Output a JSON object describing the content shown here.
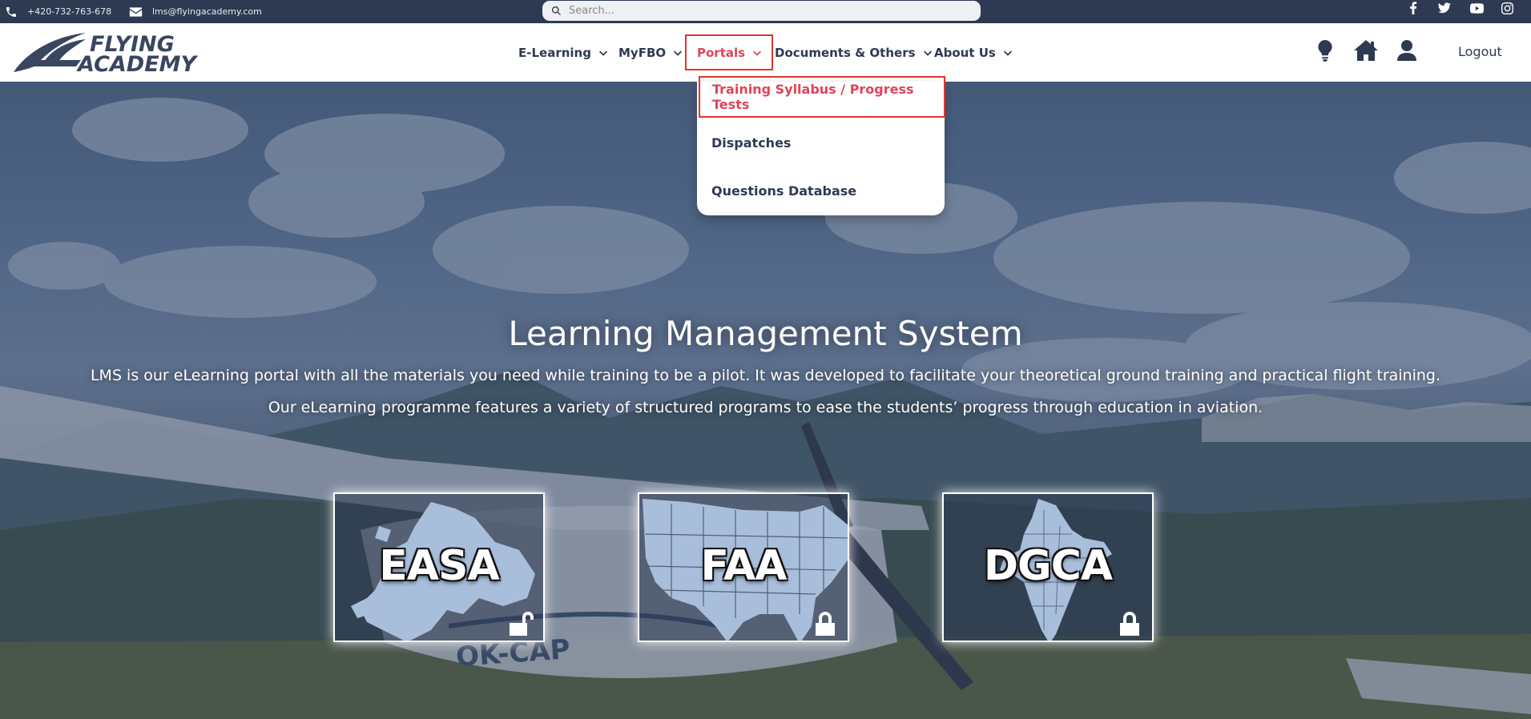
{
  "topbar": {
    "phone": "+420-732-763-678",
    "email": "lms@flyingacademy.com",
    "search_placeholder": "Search...",
    "social": [
      "facebook-icon",
      "twitter-icon",
      "youtube-icon",
      "instagram-icon"
    ]
  },
  "header": {
    "logo_text_line1": "FLYING",
    "logo_text_line2": "ACADEMY",
    "nav": [
      {
        "label": "E-Learning"
      },
      {
        "label": "MyFBO"
      },
      {
        "label": "Portals"
      },
      {
        "label": "Documents & Others"
      },
      {
        "label": "About Us"
      }
    ],
    "active_nav": "Portals",
    "icons": [
      "lightbulb-icon",
      "home-icon",
      "user-icon"
    ],
    "logout_label": "Logout"
  },
  "dropdown": {
    "items": [
      {
        "label": "Training Syllabus / Progress Tests"
      },
      {
        "label": "Dispatches"
      },
      {
        "label": "Questions Database"
      }
    ],
    "selected": "Training Syllabus / Progress Tests"
  },
  "hero": {
    "title": "Learning Management System",
    "paragraph1": "LMS is our eLearning portal with all the materials you need while training to be a pilot. It was developed to facilitate your theoretical ground training and practical flight training.",
    "paragraph2": "Our eLearning programme features a variety of structured programs to ease the students’ progress through education in aviation.",
    "background_registration": "OK-CAP",
    "cards": [
      {
        "label": "EASA",
        "lock": "unlocked-padlock-icon",
        "map": "europe-map"
      },
      {
        "label": "FAA",
        "lock": "locked-padlock-icon",
        "map": "usa-map"
      },
      {
        "label": "DGCA",
        "lock": "locked-padlock-icon",
        "map": "india-map"
      }
    ]
  },
  "colors": {
    "navy": "#2d3a52",
    "accent_red": "#e04455",
    "highlight_border": "#e0352c"
  }
}
